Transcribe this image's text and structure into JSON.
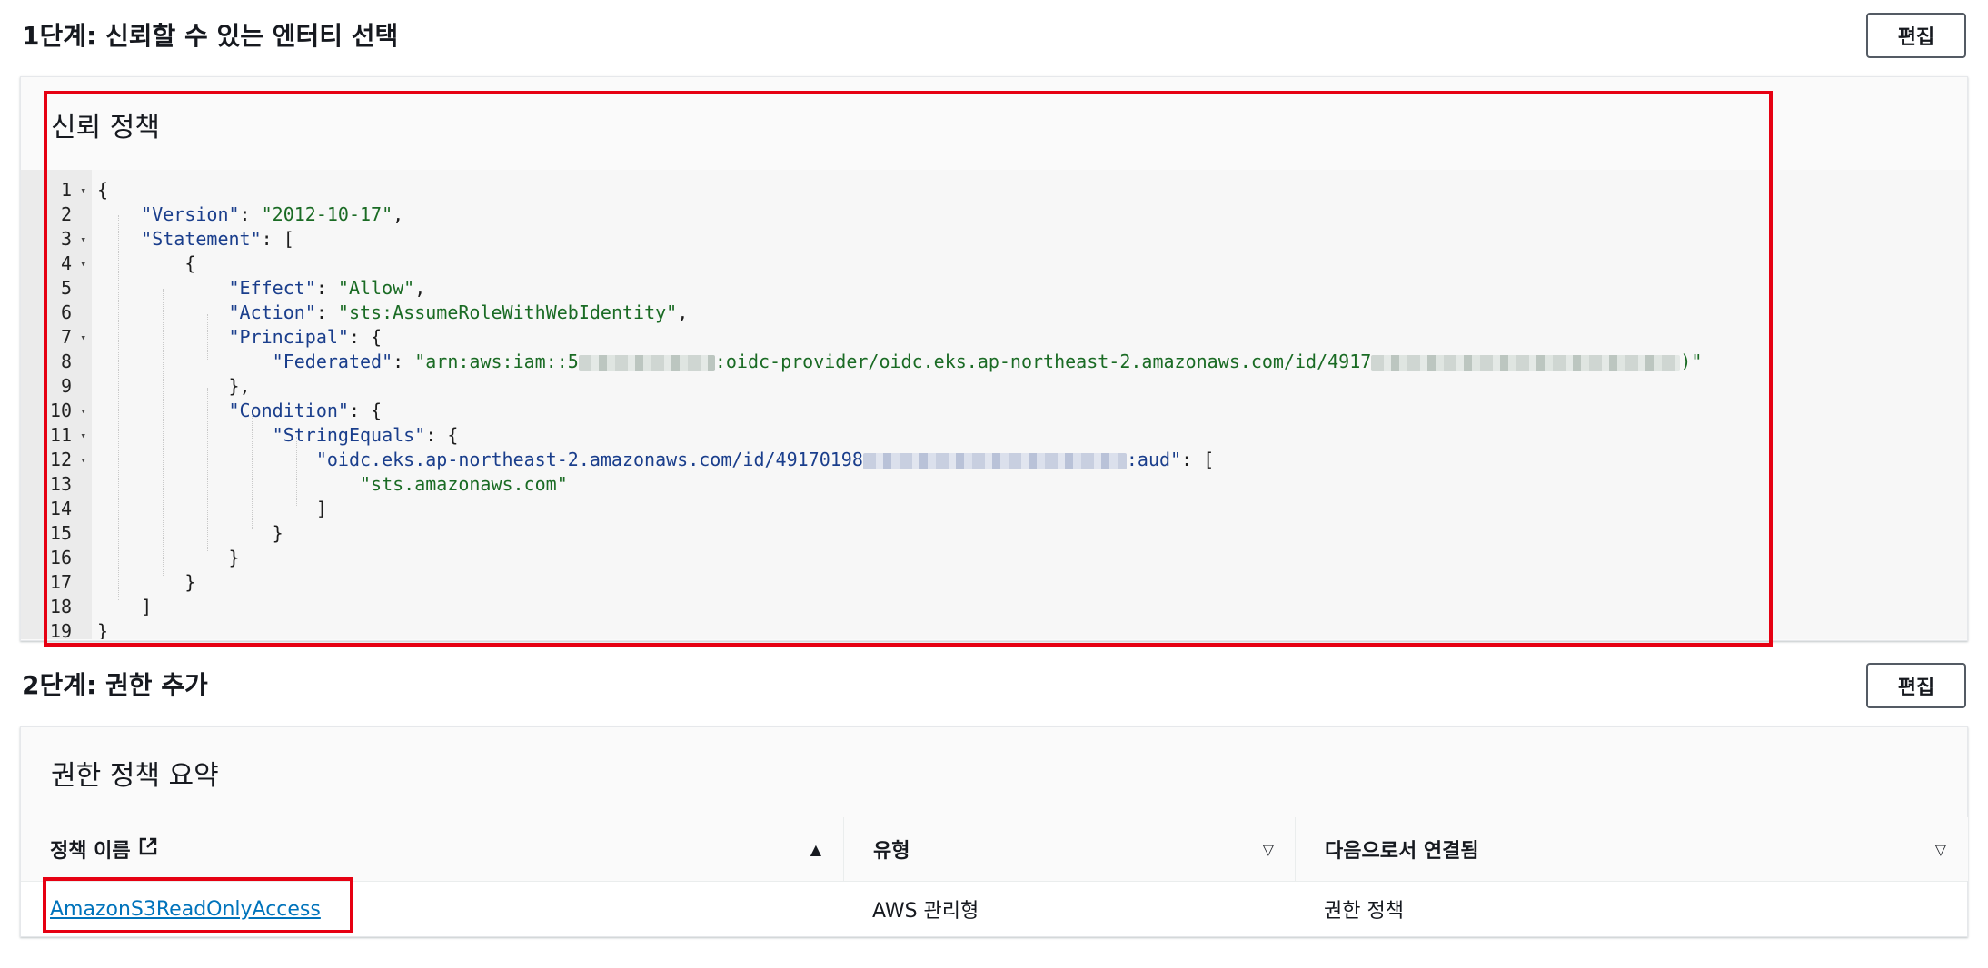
{
  "step1": {
    "title": "1단계: 신뢰할 수 있는 엔터티 선택",
    "edit_label": "편집",
    "panel_title": "신뢰 정책",
    "code_lines": [
      {
        "n": "1",
        "fold": true
      },
      {
        "n": "2",
        "fold": false
      },
      {
        "n": "3",
        "fold": true
      },
      {
        "n": "4",
        "fold": true
      },
      {
        "n": "5",
        "fold": false
      },
      {
        "n": "6",
        "fold": false
      },
      {
        "n": "7",
        "fold": true
      },
      {
        "n": "8",
        "fold": false
      },
      {
        "n": "9",
        "fold": false
      },
      {
        "n": "10",
        "fold": true
      },
      {
        "n": "11",
        "fold": true
      },
      {
        "n": "12",
        "fold": true
      },
      {
        "n": "13",
        "fold": false
      },
      {
        "n": "14",
        "fold": false
      },
      {
        "n": "15",
        "fold": false
      },
      {
        "n": "16",
        "fold": false
      },
      {
        "n": "17",
        "fold": false
      },
      {
        "n": "18",
        "fold": false
      },
      {
        "n": "19",
        "fold": false
      }
    ],
    "code": {
      "open_brace": "{",
      "version_key": "\"Version\"",
      "version_val": "\"2012-10-17\"",
      "statement_key": "\"Statement\"",
      "effect_key": "\"Effect\"",
      "effect_val": "\"Allow\"",
      "action_key": "\"Action\"",
      "action_val": "\"sts:AssumeRoleWithWebIdentity\"",
      "principal_key": "\"Principal\"",
      "federated_key": "\"Federated\"",
      "federated_val_start": "\"arn:aws:iam::5",
      "federated_val_mid": ":oidc-provider/oidc.eks.ap-northeast-2.amazonaws.com/id/4917",
      "federated_val_end": ")\"",
      "condition_key": "\"Condition\"",
      "stringequals_key": "\"StringEquals\"",
      "oidc_key_start": "\"oidc.eks.ap-northeast-2.amazonaws.com/id/49170198",
      "oidc_key_end": ":aud\"",
      "sts_val": "\"sts.amazonaws.com\""
    }
  },
  "step2": {
    "title": "2단계: 권한 추가",
    "edit_label": "편집",
    "panel_title": "권한 정책 요약",
    "columns": [
      "정책 이름",
      "유형",
      "다음으로서 연결됨"
    ],
    "rows": [
      {
        "name": "AmazonS3ReadOnlyAccess",
        "type": "AWS 관리형",
        "attached_as": "권한 정책"
      }
    ]
  },
  "colors": {
    "highlight_box": "#e60012",
    "link": "#0073bb",
    "json_key": "#1a3e8c",
    "json_string": "#1a6b24"
  }
}
